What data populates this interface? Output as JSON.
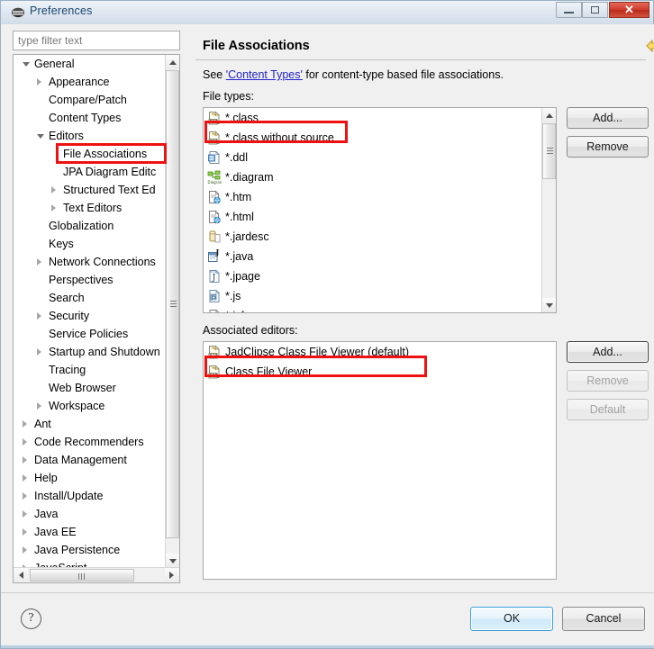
{
  "window": {
    "title": "Preferences",
    "icon": "eclipse-preferences-icon",
    "minimize_label": "Minimize",
    "maximize_label": "Restore",
    "close_label": "✕"
  },
  "filter": {
    "placeholder": "type filter text",
    "value": "type filter text"
  },
  "tree": {
    "items": [
      {
        "label": "General",
        "indent": 0,
        "arrow": "open",
        "selected": false
      },
      {
        "label": "Appearance",
        "indent": 1,
        "arrow": "closed",
        "selected": false
      },
      {
        "label": "Compare/Patch",
        "indent": 1,
        "arrow": "none",
        "selected": false
      },
      {
        "label": "Content Types",
        "indent": 1,
        "arrow": "none",
        "selected": false
      },
      {
        "label": "Editors",
        "indent": 1,
        "arrow": "open",
        "selected": false
      },
      {
        "label": "File Associations",
        "indent": 2,
        "arrow": "none",
        "selected": true
      },
      {
        "label": "JPA Diagram Editc",
        "indent": 2,
        "arrow": "none",
        "selected": false
      },
      {
        "label": "Structured Text Ed",
        "indent": 2,
        "arrow": "closed",
        "selected": false
      },
      {
        "label": "Text Editors",
        "indent": 2,
        "arrow": "closed",
        "selected": false
      },
      {
        "label": "Globalization",
        "indent": 1,
        "arrow": "none",
        "selected": false
      },
      {
        "label": "Keys",
        "indent": 1,
        "arrow": "none",
        "selected": false
      },
      {
        "label": "Network Connections",
        "indent": 1,
        "arrow": "closed",
        "selected": false
      },
      {
        "label": "Perspectives",
        "indent": 1,
        "arrow": "none",
        "selected": false
      },
      {
        "label": "Search",
        "indent": 1,
        "arrow": "none",
        "selected": false
      },
      {
        "label": "Security",
        "indent": 1,
        "arrow": "closed",
        "selected": false
      },
      {
        "label": "Service Policies",
        "indent": 1,
        "arrow": "none",
        "selected": false
      },
      {
        "label": "Startup and Shutdown",
        "indent": 1,
        "arrow": "closed",
        "selected": false
      },
      {
        "label": "Tracing",
        "indent": 1,
        "arrow": "none",
        "selected": false
      },
      {
        "label": "Web Browser",
        "indent": 1,
        "arrow": "none",
        "selected": false
      },
      {
        "label": "Workspace",
        "indent": 1,
        "arrow": "closed",
        "selected": false
      },
      {
        "label": "Ant",
        "indent": 0,
        "arrow": "closed",
        "selected": false
      },
      {
        "label": "Code Recommenders",
        "indent": 0,
        "arrow": "closed",
        "selected": false
      },
      {
        "label": "Data Management",
        "indent": 0,
        "arrow": "closed",
        "selected": false
      },
      {
        "label": "Help",
        "indent": 0,
        "arrow": "closed",
        "selected": false
      },
      {
        "label": "Install/Update",
        "indent": 0,
        "arrow": "closed",
        "selected": false
      },
      {
        "label": "Java",
        "indent": 0,
        "arrow": "closed",
        "selected": false
      },
      {
        "label": "Java EE",
        "indent": 0,
        "arrow": "closed",
        "selected": false
      },
      {
        "label": "Java Persistence",
        "indent": 0,
        "arrow": "closed",
        "selected": false
      },
      {
        "label": "JavaScript",
        "indent": 0,
        "arrow": "closed",
        "selected": false
      }
    ]
  },
  "page": {
    "title": "File Associations",
    "see_prefix": "See ",
    "see_link": "'Content Types'",
    "see_suffix": " for content-type based file associations.",
    "file_types_label": "File types:",
    "associated_editors_label": "Associated editors:"
  },
  "nav": {
    "back_icon": "back-arrow-icon",
    "back_menu_icon": "chevron-down-icon",
    "forward_icon": "forward-arrow-icon",
    "forward_menu_icon": "chevron-down-icon",
    "view_menu_icon": "chevron-down-icon"
  },
  "file_types": [
    {
      "label": "*.class",
      "icon": "class-file-icon",
      "selected": false
    },
    {
      "label": "*.class without source",
      "icon": "class-file-icon",
      "selected": true
    },
    {
      "label": "*.ddl",
      "icon": "ddl-file-icon",
      "selected": false
    },
    {
      "label": "*.diagram",
      "icon": "diagram-file-icon",
      "selected": false
    },
    {
      "label": "*.htm",
      "icon": "html-file-icon",
      "selected": false
    },
    {
      "label": "*.html",
      "icon": "html-file-icon",
      "selected": false
    },
    {
      "label": "*.jardesc",
      "icon": "jardesc-file-icon",
      "selected": false
    },
    {
      "label": "*.java",
      "icon": "java-file-icon",
      "selected": false
    },
    {
      "label": "*.jpage",
      "icon": "jpage-file-icon",
      "selected": false
    },
    {
      "label": "*.js",
      "icon": "js-file-icon",
      "selected": false
    },
    {
      "label": "*.jsf",
      "icon": "jsf-file-icon",
      "selected": false
    }
  ],
  "associated_editors": [
    {
      "label": "JadClipse Class File Viewer (default)",
      "icon": "class-file-icon",
      "selected": true
    },
    {
      "label": "Class File Viewer",
      "icon": "class-file-icon",
      "selected": false
    }
  ],
  "buttons": {
    "filetypes_add": "Add...",
    "filetypes_remove": "Remove",
    "editors_add": "Add...",
    "editors_remove": "Remove",
    "editors_default": "Default",
    "ok": "OK",
    "cancel": "Cancel",
    "help": "?"
  },
  "colors": {
    "annotation": "#ee1111",
    "link": "#2222cc",
    "default_button_border": "#3c9fd6",
    "close_button": "#cf3c2c",
    "title_text": "#17456b"
  }
}
